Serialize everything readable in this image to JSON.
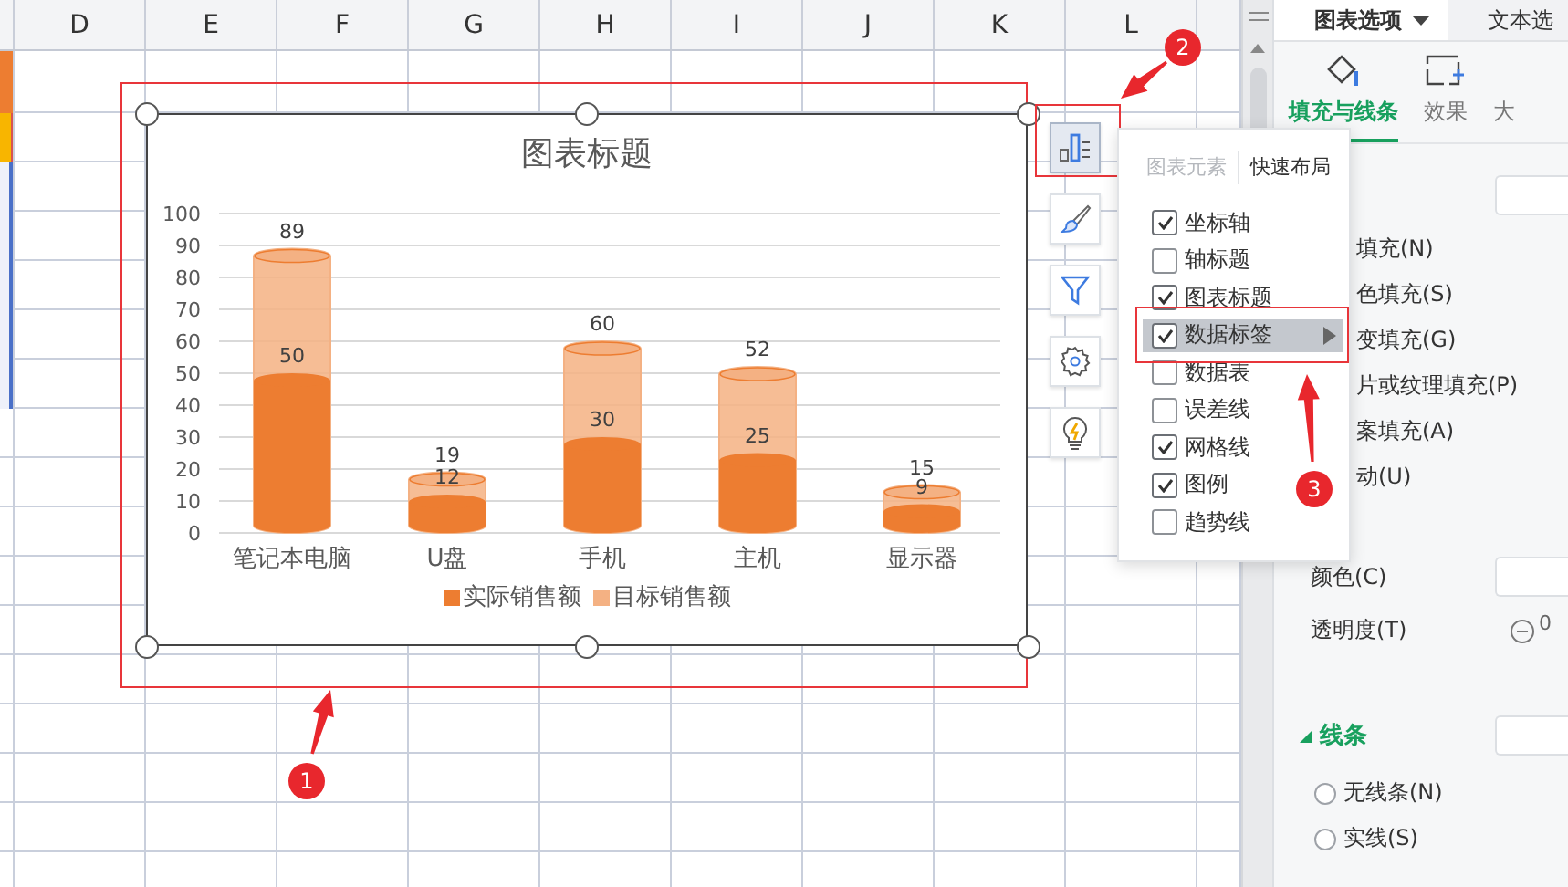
{
  "sheet": {
    "columns": [
      "D",
      "E",
      "F",
      "G",
      "H",
      "I",
      "J",
      "K",
      "L"
    ]
  },
  "chart": {
    "title": "图表标题",
    "chart_data": {
      "type": "bar",
      "categories": [
        "笔记本电脑",
        "U盘",
        "手机",
        "主机",
        "显示器"
      ],
      "series": [
        {
          "name": "实际销售额",
          "color": "#ed7d31",
          "values": [
            50,
            12,
            30,
            25,
            9
          ]
        },
        {
          "name": "目标销售额",
          "color": "#f4b183",
          "values": [
            89,
            19,
            60,
            52,
            15
          ]
        }
      ],
      "ylim": [
        0,
        100
      ],
      "yticks": [
        0,
        10,
        20,
        30,
        40,
        50,
        60,
        70,
        80,
        90,
        100
      ],
      "grid": true,
      "data_labels": true,
      "stacked": false,
      "orientation": "vertical"
    }
  },
  "chart_tools": [
    {
      "kind": "elements",
      "selected": true
    },
    {
      "kind": "style",
      "selected": false
    },
    {
      "kind": "filter",
      "selected": false
    },
    {
      "kind": "settings",
      "selected": false
    },
    {
      "kind": "ideas",
      "selected": false
    }
  ],
  "elements_popup": {
    "tabs": [
      {
        "label": "图表元素",
        "selected": true
      },
      {
        "label": "快速布局",
        "selected": false
      }
    ],
    "items": [
      {
        "label": "坐标轴",
        "checked": true,
        "selected": false
      },
      {
        "label": "轴标题",
        "checked": false,
        "selected": false
      },
      {
        "label": "图表标题",
        "checked": true,
        "selected": false
      },
      {
        "label": "数据标签",
        "checked": true,
        "selected": true
      },
      {
        "label": "数据表",
        "checked": false,
        "selected": false
      },
      {
        "label": "误差线",
        "checked": false,
        "selected": false
      },
      {
        "label": "网格线",
        "checked": true,
        "selected": false
      },
      {
        "label": "图例",
        "checked": true,
        "selected": false
      },
      {
        "label": "趋势线",
        "checked": false,
        "selected": false
      }
    ]
  },
  "annotations": [
    "1",
    "2",
    "3"
  ],
  "format_panel": {
    "tabs": [
      {
        "label": "图表选项",
        "selected": true
      },
      {
        "label": "文本选",
        "selected": false
      }
    ],
    "subtabs": [
      {
        "label": "填充与线条",
        "kind": "fill",
        "selected": true
      },
      {
        "label": "效果",
        "kind": "effect",
        "selected": false
      },
      {
        "label": "大",
        "kind": "size",
        "selected": false
      }
    ],
    "fill_options": [
      "填充(N)",
      "色填充(S)",
      "变填充(G)",
      "片或纹理填充(P)",
      "案填充(A)",
      "动(U)"
    ],
    "color_label": "颜色(C)",
    "transparency_label": "透明度(T)",
    "transparency_value": "0",
    "line_section": {
      "title": "线条",
      "expanded": true
    },
    "line_options": [
      {
        "label": "无线条(N)",
        "selected": false
      },
      {
        "label": "实线(S)",
        "selected": false
      }
    ]
  }
}
